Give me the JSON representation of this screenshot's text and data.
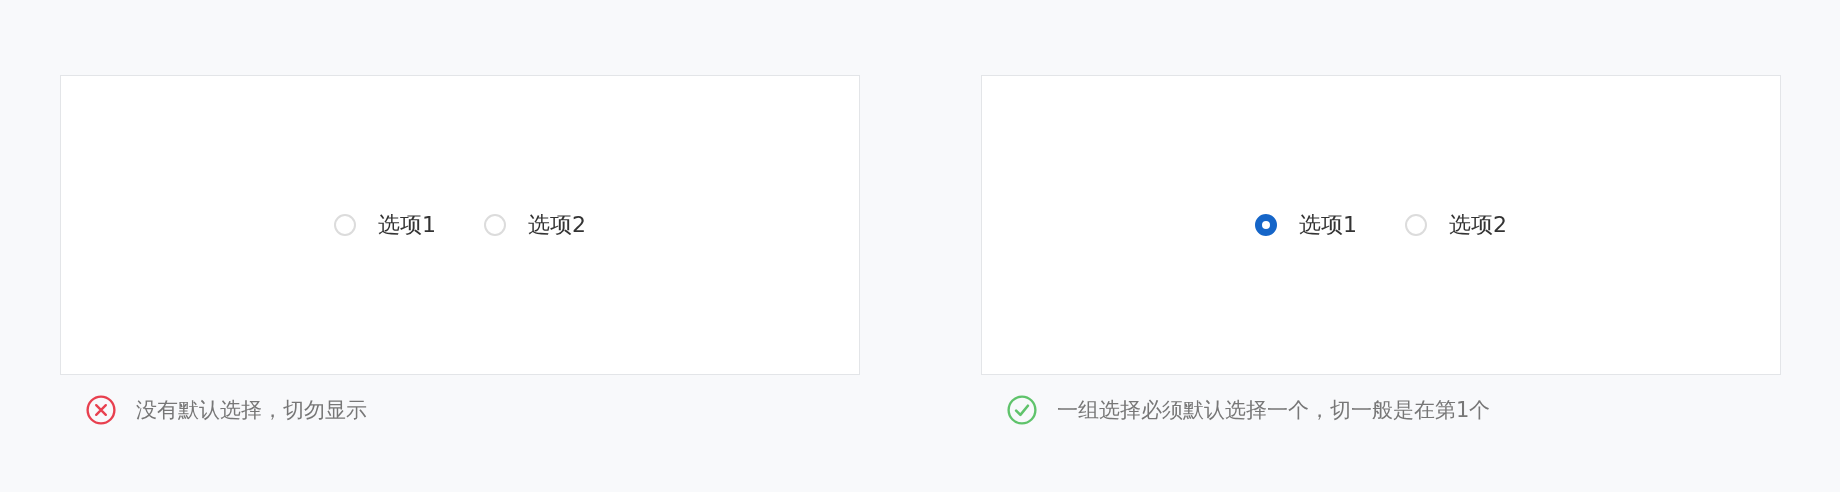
{
  "examples": [
    {
      "kind": "wrong",
      "options": [
        {
          "label": "选项1",
          "selected": false
        },
        {
          "label": "选项2",
          "selected": false
        }
      ],
      "caption": "没有默认选择，切勿显示"
    },
    {
      "kind": "correct",
      "options": [
        {
          "label": "选项1",
          "selected": true
        },
        {
          "label": "选项2",
          "selected": false
        }
      ],
      "caption": "一组选择必须默认选择一个，切一般是在第1个"
    }
  ]
}
